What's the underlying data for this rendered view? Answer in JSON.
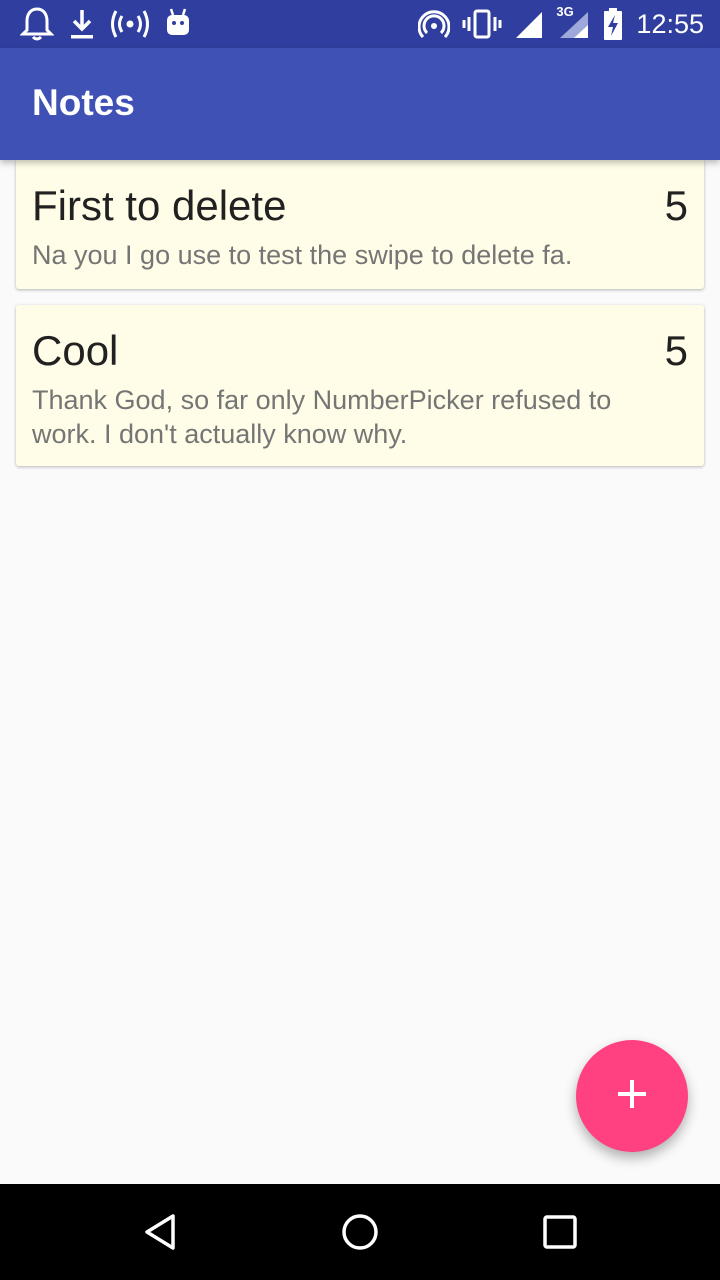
{
  "status_bar": {
    "time": "12:55",
    "network_label": "3G",
    "left_icons": [
      "notification-bell-icon",
      "download-icon",
      "broadcast-icon",
      "android-icon"
    ],
    "right_icons": [
      "hotspot-icon",
      "vibrate-icon",
      "signal-icon",
      "signal-3g-icon",
      "battery-charging-icon"
    ]
  },
  "app_bar": {
    "title": "Notes"
  },
  "notes": [
    {
      "title": "First to delete",
      "count": "5",
      "body": "Na you I go use to test the swipe to delete fa."
    },
    {
      "title": "Cool",
      "count": "5",
      "body": "Thank God, so far only NumberPicker refused to work. I don't actually know why."
    }
  ],
  "fab": {
    "icon": "plus-icon"
  },
  "nav_bar": {
    "buttons": [
      "back-icon",
      "home-icon",
      "recents-icon"
    ]
  },
  "colors": {
    "status_bar": "#303f9f",
    "app_bar": "#3f51b5",
    "card_background": "#fffde7",
    "fab": "#ff4081",
    "background": "#fafafa"
  }
}
